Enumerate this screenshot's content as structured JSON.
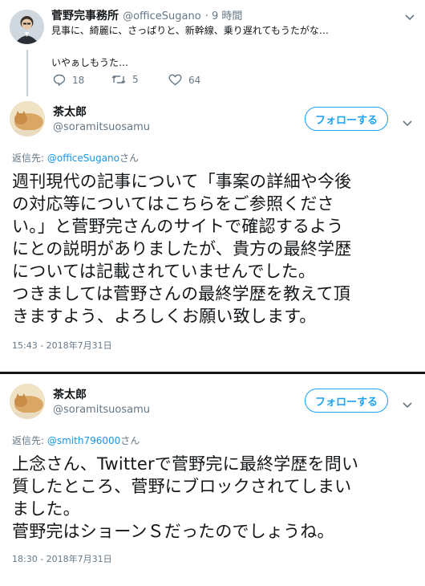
{
  "tweet1": {
    "name": "菅野完事務所",
    "handle": "@officeSugano",
    "time": "· 9 時間",
    "text_line1": "見事に、綺麗に、さっぱりと、新幹線、乗り遅れてもうたがな…",
    "text_line2": "いやぁしもうた…",
    "replies": "18",
    "retweets": "5",
    "likes": "64"
  },
  "tweet2": {
    "name": "茶太郎",
    "handle": "@soramitsuosamu",
    "follow_label": "フォローする",
    "reply_prefix": "返信先: ",
    "reply_to": "@officeSugano",
    "reply_suffix": "さん",
    "lines": [
      "週刊現代の記事について「事案の詳細や今後",
      "の対応等についてはこちらをご参照くださ",
      "い。」と菅野完さんのサイトで確認するよう",
      "にとの説明がありましたが、貴方の最終学歴",
      "については記載されていませんでした。",
      "つきましては菅野さんの最終学歴を教えて頂",
      "きますよう、よろしくお願い致します。"
    ],
    "timestamp": "15:43 - 2018年7月31日"
  },
  "tweet3": {
    "name": "茶太郎",
    "handle": "@soramitsuosamu",
    "follow_label": "フォローする",
    "reply_prefix": "返信先: ",
    "reply_to": "@smith796000",
    "reply_suffix": "さん",
    "lines": [
      "上念さん、Twitterで菅野完に最終学歴を問い",
      "質したところ、菅野にブロックされてしまい",
      "ました。",
      "菅野完はショーンＳだったのでしょうね。"
    ],
    "timestamp": "18:30 - 2018年7月31日"
  },
  "colors": {
    "accent": "#1da1f2",
    "link": "#1b95e0",
    "muted": "#657786",
    "text": "#14171a"
  }
}
